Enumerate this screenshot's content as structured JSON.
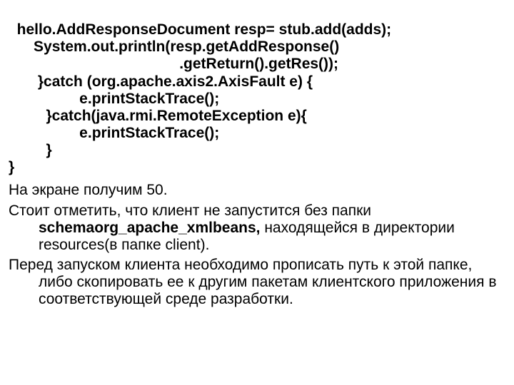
{
  "code": {
    "l1": "  hello.AddResponseDocument resp= stub.add(adds);",
    "l2": "      System.out.println(resp.getAddResponse()",
    "l3": "                                         .getReturn().getRes());",
    "l4": "       }catch (org.apache.axis2.AxisFault e) {",
    "l5": "                 e.printStackTrace();",
    "l6": "         }catch(java.rmi.RemoteException e){",
    "l7": "                 e.printStackTrace();",
    "l8": "         }",
    "l9": "}"
  },
  "body": {
    "p1": "На экране получим 50.",
    "p2_a": "Стоит отметить, что клиент не запустится без папки ",
    "p2_bold": "schemaorg_apache_xmlbeans,",
    "p2_b": " находящейся в директории resources(в папке client).",
    "p3": "Перед запуском клиента необходимо прописать путь к этой папке, либо скопировать ее к другим пакетам клиентского приложения в соответствующей среде разработки."
  }
}
